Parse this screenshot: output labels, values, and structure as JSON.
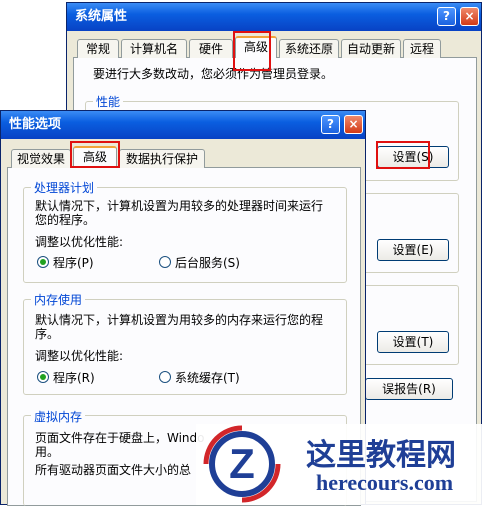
{
  "back_window": {
    "title": "系统属性",
    "help_button": "?",
    "close_button": "×",
    "tabs": [
      "常规",
      "计算机名",
      "硬件",
      "高级",
      "系统还原",
      "自动更新",
      "远程"
    ],
    "notice": "要进行大多数改动，您必须作为管理员登录。",
    "perf_group_title": "性能",
    "settings_buttons": [
      "设置(S)",
      "设置(E)",
      "设置(T)"
    ],
    "error_report_button": "误报告(R)"
  },
  "front_window": {
    "title": "性能选项",
    "help_button": "?",
    "close_button": "×",
    "tabs": [
      "视觉效果",
      "高级",
      "数据执行保护"
    ],
    "cpu": {
      "title": "处理器计划",
      "desc_line1": "默认情况下，计算机设置为用较多的处理器时间来运行",
      "desc_line2": "您的程序。",
      "adjust_label": "调整以优化性能:",
      "option_programs": "程序(P)",
      "option_services": "后台服务(S)"
    },
    "memory": {
      "title": "内存使用",
      "desc_line1": "默认情况下，计算机设置为用较多的内存来运行您的程",
      "desc_line2": "序。",
      "adjust_label": "调整以优化性能:",
      "option_programs": "程序(R)",
      "option_cache": "系统缓存(T)"
    },
    "virtual": {
      "title": "虚拟内存",
      "desc_line1": "页面文件存在于硬盘上，Windo",
      "desc_line2": "用。",
      "desc_line3": "所有驱动器页面文件大小的总"
    }
  },
  "watermark": {
    "logo_letter": "Z",
    "title": "这里教程网",
    "url": "herecours.com"
  }
}
